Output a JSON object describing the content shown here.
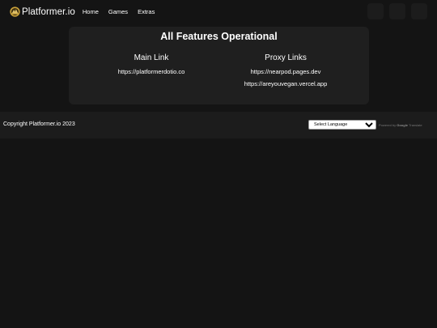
{
  "header": {
    "brand_name": "Platformer.io",
    "nav": [
      {
        "label": "Home"
      },
      {
        "label": "Games"
      },
      {
        "label": "Extras"
      }
    ]
  },
  "status": {
    "title": "All Features Operational",
    "main": {
      "heading": "Main Link",
      "links": [
        "https://platformerdotio.co"
      ]
    },
    "proxy": {
      "heading": "Proxy Links",
      "links": [
        "https://nearpod.pages.dev",
        "https://areyouvegan.vercel.app"
      ]
    }
  },
  "footer": {
    "copyright": "Copyright Platformer.io 2023",
    "language_select": {
      "selected": "Select Language"
    },
    "powered_by": "Powered by",
    "google": "Google",
    "translate": "Translate"
  },
  "colors": {
    "background": "#141414",
    "card": "#1f1f1f",
    "footer": "#1c1c1c",
    "logo_gold": "#c9a13a"
  }
}
